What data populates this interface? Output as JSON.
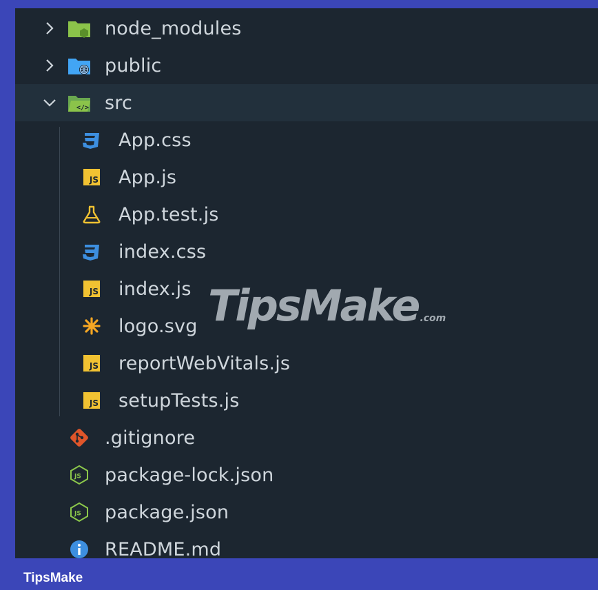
{
  "explorer": {
    "folders": [
      {
        "name": "node_modules",
        "expanded": false,
        "icon": "folder-node-icon"
      },
      {
        "name": "public",
        "expanded": false,
        "icon": "folder-public-icon"
      },
      {
        "name": "src",
        "expanded": true,
        "icon": "folder-src-icon"
      }
    ],
    "src_files": [
      {
        "name": "App.css",
        "icon": "css-icon"
      },
      {
        "name": "App.js",
        "icon": "js-icon"
      },
      {
        "name": "App.test.js",
        "icon": "test-flask-icon"
      },
      {
        "name": "index.css",
        "icon": "css-icon"
      },
      {
        "name": "index.js",
        "icon": "js-icon"
      },
      {
        "name": "logo.svg",
        "icon": "svg-asterisk-icon"
      },
      {
        "name": "reportWebVitals.js",
        "icon": "js-icon"
      },
      {
        "name": "setupTests.js",
        "icon": "js-icon"
      }
    ],
    "root_files": [
      {
        "name": ".gitignore",
        "icon": "git-icon"
      },
      {
        "name": "package-lock.json",
        "icon": "nodejs-icon"
      },
      {
        "name": "package.json",
        "icon": "nodejs-icon"
      },
      {
        "name": "README.md",
        "icon": "info-icon"
      }
    ],
    "js_badge_text": "JS"
  },
  "watermark": {
    "main": "TipsMake",
    "suffix": ".com"
  },
  "footer": {
    "brand": "TipsMake"
  },
  "colors": {
    "frame": "#3b46b8",
    "panel": "#1c2630",
    "selected_row": "#22303c",
    "text": "#cfd6dc",
    "css_blue": "#3d8fe0",
    "js_yellow": "#f1c232",
    "folder_green": "#8bc34a",
    "folder_blue": "#42a5f5",
    "git_orange": "#e0562a",
    "node_green": "#8cc84b",
    "info_blue": "#3d8fe0"
  }
}
